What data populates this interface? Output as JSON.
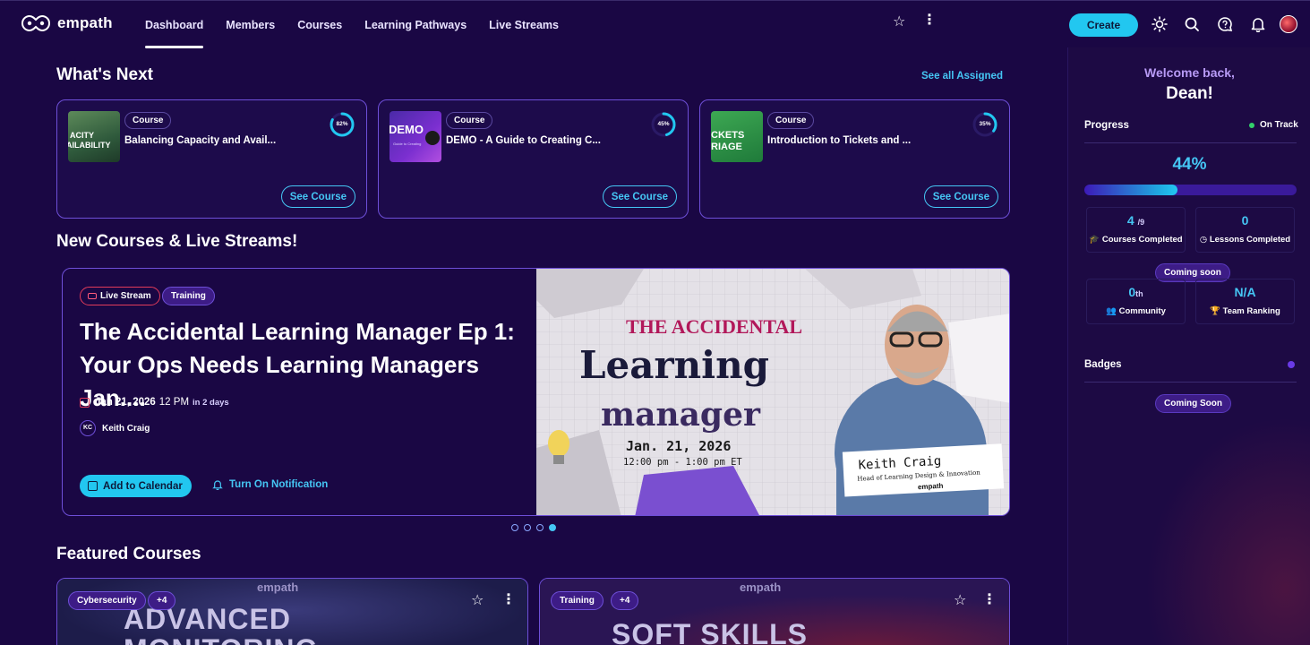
{
  "brand": {
    "name": "empath"
  },
  "nav": {
    "links": [
      "Dashboard",
      "Members",
      "Courses",
      "Learning Pathways",
      "Live Streams"
    ],
    "active": "Dashboard",
    "create_label": "Create"
  },
  "whats_next": {
    "title": "What's Next",
    "see_all": "See all Assigned",
    "cards": [
      {
        "tag": "Course",
        "name": "Balancing Capacity and Avail...",
        "progress_label": "82%",
        "progress": 0.82,
        "button": "See Course",
        "thumb_text": "ACITY\nAILABILITY"
      },
      {
        "tag": "Course",
        "name": "DEMO - A Guide to Creating C...",
        "progress_label": "45%",
        "progress": 0.45,
        "button": "See Course",
        "thumb_text": "DEMO"
      },
      {
        "tag": "Course",
        "name": "Introduction to Tickets and ...",
        "progress_label": "35%",
        "progress": 0.35,
        "button": "See Course",
        "thumb_text": "CKETS\nRIAGE"
      }
    ]
  },
  "new_streams": {
    "title": "New Courses & Live Streams!",
    "stream": {
      "pill_live": "Live Stream",
      "pill_type": "Training",
      "title_line1": "The Accidental Learning Manager Ep 1:",
      "title_line2": "Your Ops Needs Learning Managers Jan....",
      "date": "Jan 21, 2026",
      "time": "12 PM",
      "relative": "in 2 days",
      "host_initials": "KC",
      "host_name": "Keith Craig",
      "add_calendar": "Add to Calendar",
      "notify": "Turn On Notification",
      "image": {
        "line1": "THE ACCIDENTAL",
        "line2": "Learning",
        "line3": "manager",
        "date": "Jan. 21, 2026",
        "time": "12:00 pm - 1:00 pm ET",
        "person": "Keith Craig",
        "role": "Head of Learning Design & Innovation",
        "logo": "empath"
      }
    },
    "carousel_count": 4,
    "carousel_active": 3
  },
  "featured": {
    "title": "Featured Courses",
    "cards": [
      {
        "tag": "Cybersecurity",
        "extra": "+4",
        "big_text": "ADVANCED\nMONITORING",
        "logo": "empath"
      },
      {
        "tag": "Training",
        "extra": "+4",
        "big_text": "SOFT SKILLS",
        "logo": "empath"
      }
    ]
  },
  "panel": {
    "welcome": "Welcome back,",
    "name": "Dean!",
    "progress_label": "Progress",
    "status": "On Track",
    "percent_label": "44%",
    "percent": 0.44,
    "courses_completed": "4",
    "courses_total": "/9",
    "courses_completed_label": "Courses Completed",
    "lessons_completed": "0",
    "lessons_completed_label": "Lessons Completed",
    "coming_soon_1": "Coming soon",
    "community": "0",
    "community_suffix": "th",
    "community_label": "Community",
    "team_ranking": "N/A",
    "team_ranking_label": "Team Ranking",
    "badges_label": "Badges",
    "coming_soon_2": "Coming Soon"
  },
  "colors": {
    "bg": "#1a0744",
    "accent": "#22c7f0",
    "link": "#45c6f4",
    "border": "#6e4fd8",
    "status_green": "#33d16a"
  }
}
